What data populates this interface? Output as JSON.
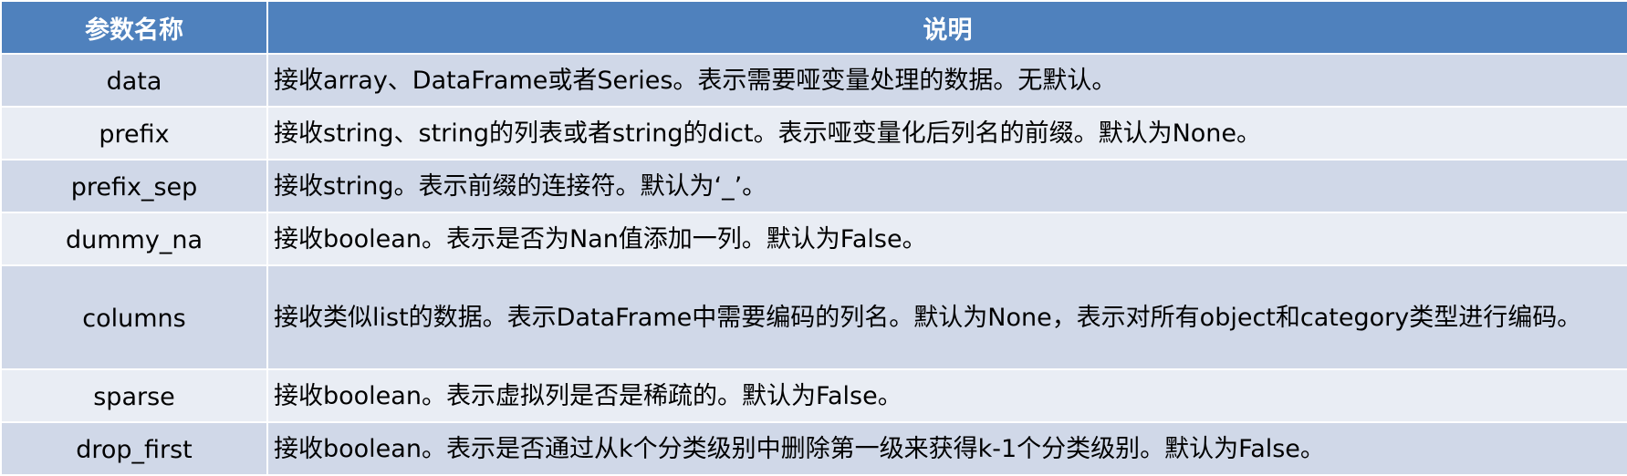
{
  "table": {
    "headers": {
      "name": "参数名称",
      "description": "说明"
    },
    "rows": [
      {
        "name": "data",
        "description": "接收array、DataFrame或者Series。表示需要哑变量处理的数据。无默认。"
      },
      {
        "name": "prefix",
        "description": "接收string、string的列表或者string的dict。表示哑变量化后列名的前缀。默认为None。"
      },
      {
        "name": "prefix_sep",
        "description": "接收string。表示前缀的连接符。默认为‘_’。"
      },
      {
        "name": "dummy_na",
        "description": "接收boolean。表示是否为Nan值添加一列。默认为False。"
      },
      {
        "name": "columns",
        "description": "接收类似list的数据。表示DataFrame中需要编码的列名。默认为None，表示对所有object和category类型进行编码。"
      },
      {
        "name": "sparse",
        "description": "接收boolean。表示虚拟列是否是稀疏的。默认为False。"
      },
      {
        "name": "drop_first",
        "description": "接收boolean。表示是否通过从k个分类级别中删除第一级来获得k-1个分类级别。默认为False。"
      }
    ]
  },
  "colors": {
    "header_bg": "#4f81bd",
    "row_odd_bg": "#d0d8e8",
    "row_even_bg": "#e9edf4",
    "header_text": "#ffffff"
  }
}
